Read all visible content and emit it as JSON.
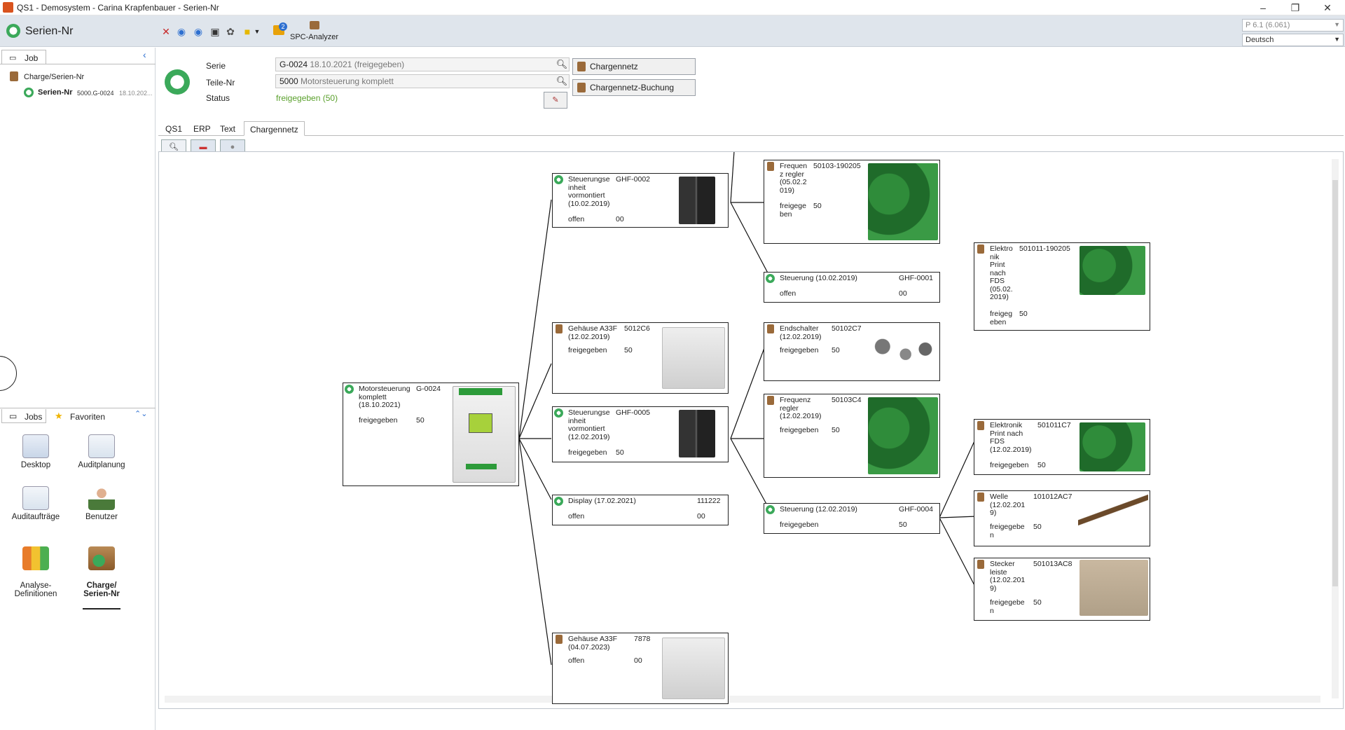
{
  "window": {
    "title": "QS1 - Demosystem - Carina Krapfenbauer - Serien-Nr",
    "controls": [
      "–",
      "❐",
      "✕"
    ]
  },
  "header": {
    "module_name": "Serien-Nr",
    "spc_label": "SPC-Analyzer",
    "spc_badge": "2",
    "version": "P 6.1 (6.061)",
    "language": "Deutsch"
  },
  "left": {
    "tab_job": "Job",
    "tree_parent": "Charge/Serien-Nr",
    "tree_child_label": "Serien-Nr",
    "tree_child_value": "5000.G-0024",
    "tree_child_date": "18.10.202...",
    "tab_jobs": "Jobs",
    "tab_favorites": "Favoriten",
    "nav": [
      {
        "label": "Desktop"
      },
      {
        "label": "Auditplanung"
      },
      {
        "label": "Auditaufträge"
      },
      {
        "label": "Benutzer"
      },
      {
        "label": "Analyse-\nDefinitionen"
      },
      {
        "label": "Charge/\nSerien-Nr"
      }
    ]
  },
  "form": {
    "serie_label": "Serie",
    "serie_value": "G-0024",
    "serie_extra": "18.10.2021 (freigegeben)",
    "teile_label": "Teile-Nr",
    "teile_value": "5000",
    "teile_extra": "Motorsteuerung komplett",
    "status_label": "Status",
    "status_value": "freigegeben (50)",
    "btn_chargennetz": "Chargennetz",
    "btn_buchung": "Chargennetz-Buchung"
  },
  "tabs": [
    "QS1",
    "ERP",
    "Text",
    "Chargennetz"
  ],
  "colors": {
    "status_green": "#5aa02c",
    "accent_green": "#3ba95a"
  },
  "nodes": {
    "root": {
      "name": "Motorsteuerung\nkomplett\n(18.10.2021)",
      "id": "G-0024",
      "status": "freigegeben",
      "qty": "50"
    },
    "n1": {
      "name": "Steuerungse\ninheit\nvormontiert\n(10.02.2019)",
      "id": "GHF-0002",
      "status": "offen",
      "qty": "00"
    },
    "n2": {
      "name": "Gehäuse A33F\n(12.02.2019)",
      "id": "5012C6",
      "status": "freigegeben",
      "qty": "50"
    },
    "n3": {
      "name": "Steuerungse\ninheit\nvormontiert\n(12.02.2019)",
      "id": "GHF-0005",
      "status": "freigegeben",
      "qty": "50"
    },
    "n4": {
      "name": "Display (17.02.2021)",
      "id": "111222",
      "status": "offen",
      "qty": "00"
    },
    "n5": {
      "name": "Gehäuse A33F\n(04.07.2023)",
      "id": "7878",
      "status": "offen",
      "qty": "00"
    },
    "m1": {
      "name": "Frequen\nz regler\n(05.02.2\n019)",
      "id": "50103-190205",
      "status": "freigege\nben",
      "qty": "50"
    },
    "m2": {
      "name": "Steuerung (10.02.2019)",
      "id": "GHF-0001",
      "status": "offen",
      "qty": "00"
    },
    "m3": {
      "name": "Endschalter\n(12.02.2019)",
      "id": "50102C7",
      "status": "freigegeben",
      "qty": "50"
    },
    "m4": {
      "name": "Frequenz\nregler\n(12.02.2019)",
      "id": "50103C4",
      "status": "freigegeben",
      "qty": "50"
    },
    "m5": {
      "name": "Steuerung (12.02.2019)",
      "id": "GHF-0004",
      "status": "freigegeben",
      "qty": "50"
    },
    "r1": {
      "name": "Elektro\nnik\nPrint\nnach\nFDS\n(05.02.\n2019)",
      "id": "501011-190205",
      "status": "freigeg\neben",
      "qty": "50"
    },
    "r2": {
      "name": "Elektronik\nPrint nach\nFDS\n(12.02.2019)",
      "id": "501011C7",
      "status": "freigegeben",
      "qty": "50"
    },
    "r3": {
      "name": "Welle\n(12.02.201\n9)",
      "id": "101012AC7",
      "status": "freigegebe\nn",
      "qty": "50"
    },
    "r4": {
      "name": "Stecker\nleiste\n(12.02.201\n9)",
      "id": "501013AC8",
      "status": "freigegebe\nn",
      "qty": "50"
    }
  }
}
